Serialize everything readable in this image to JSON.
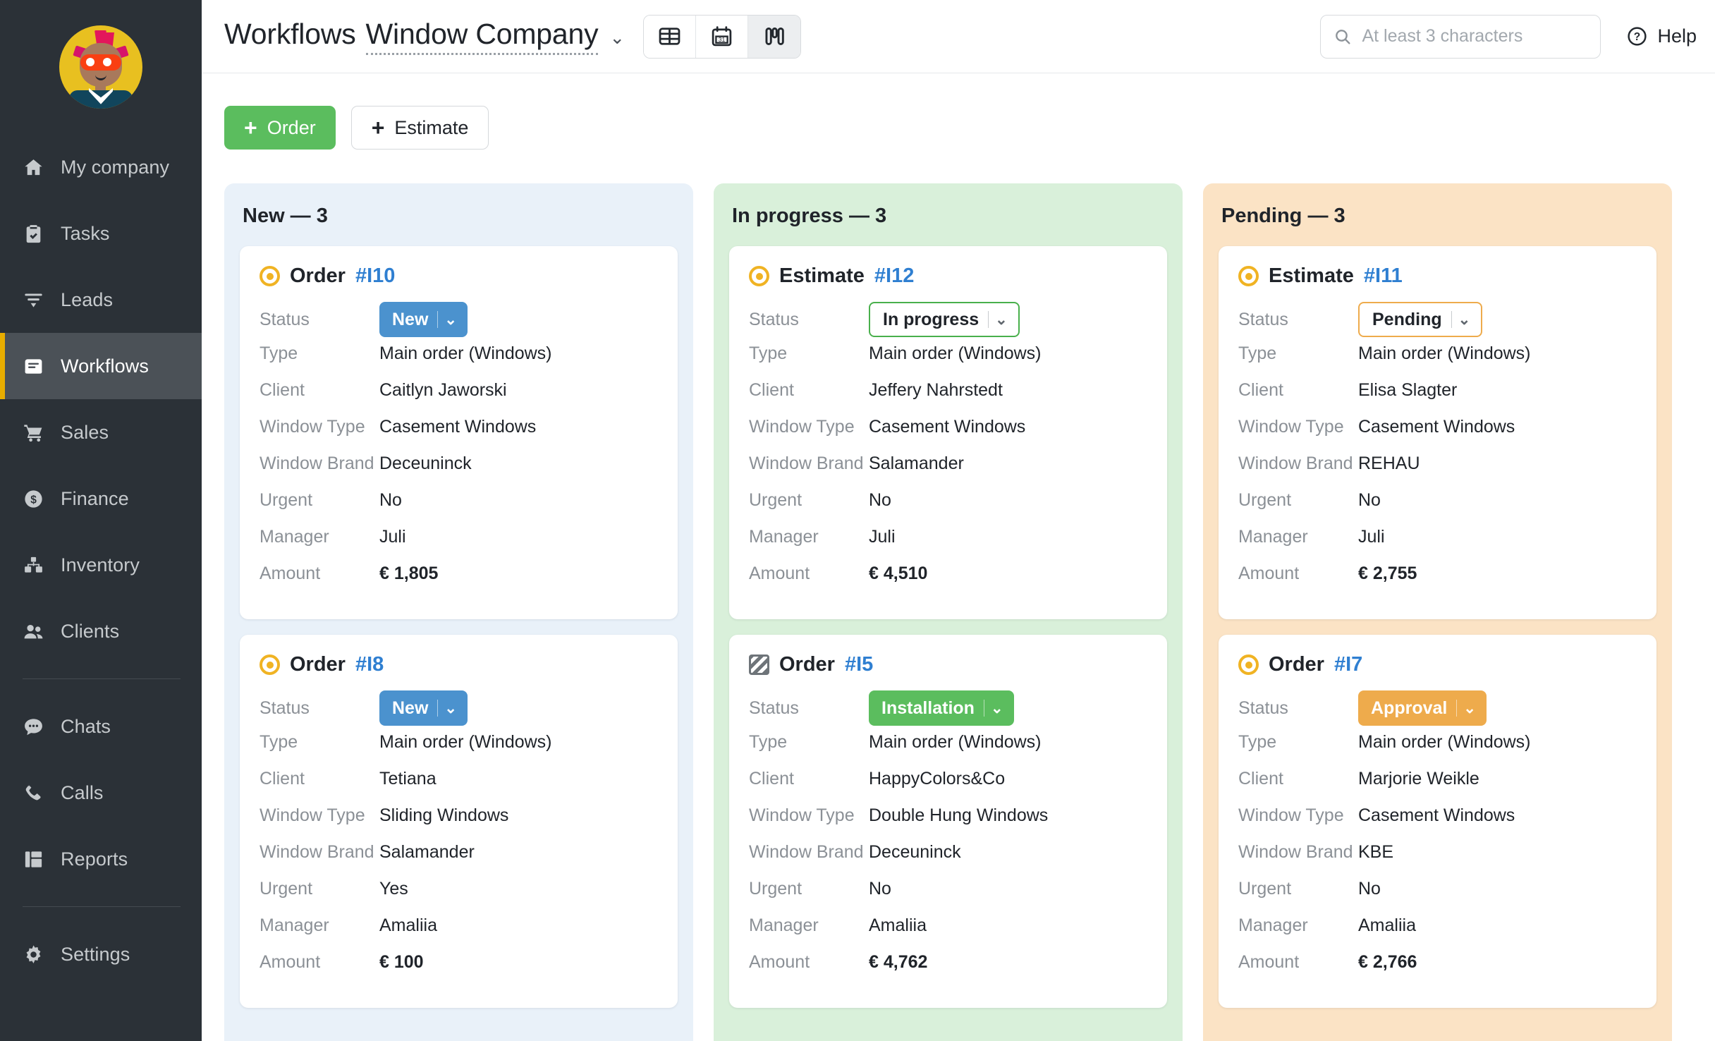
{
  "sidebar": {
    "avatar_name": "user-avatar",
    "items": [
      {
        "label": "My company",
        "icon": "home-icon",
        "active": false
      },
      {
        "label": "Tasks",
        "icon": "clipboard-check-icon",
        "active": false
      },
      {
        "label": "Leads",
        "icon": "funnel-icon",
        "active": false
      },
      {
        "label": "Workflows",
        "icon": "workflows-icon",
        "active": true
      },
      {
        "label": "Sales",
        "icon": "cart-icon",
        "active": false
      },
      {
        "label": "Finance",
        "icon": "dollar-circle-icon",
        "active": false
      },
      {
        "label": "Inventory",
        "icon": "boxes-icon",
        "active": false
      },
      {
        "label": "Clients",
        "icon": "people-icon",
        "active": false
      },
      {
        "label": "Chats",
        "icon": "chat-bubble-icon",
        "active": false
      },
      {
        "label": "Calls",
        "icon": "phone-icon",
        "active": false
      },
      {
        "label": "Reports",
        "icon": "reports-grid-icon",
        "active": false
      },
      {
        "label": "Settings",
        "icon": "gear-icon",
        "active": false
      }
    ]
  },
  "header": {
    "page_title": "Workflows",
    "company": "Window Company",
    "company_chevron": "⌄",
    "views": [
      {
        "name": "table-view",
        "icon": "table-icon",
        "active": false
      },
      {
        "name": "calendar-view",
        "icon": "calendar-31-icon",
        "active": false
      },
      {
        "name": "kanban-view",
        "icon": "kanban-icon",
        "active": true
      }
    ],
    "search": {
      "placeholder": "At least 3 characters",
      "value": "",
      "icon": "search-icon"
    },
    "help": {
      "label": "Help",
      "icon": "question-circle-icon"
    }
  },
  "toolbar": {
    "order_label": "Order",
    "estimate_label": "Estimate",
    "plus": "+"
  },
  "field_labels": {
    "status": "Status",
    "type": "Type",
    "client": "Client",
    "window_type": "Window Type",
    "window_brand": "Window Brand",
    "urgent": "Urgent",
    "manager": "Manager",
    "amount": "Amount"
  },
  "colors": {
    "column_new": "#e9f1f9",
    "column_in_progress": "#d9f0da",
    "column_pending": "#fbe3c5",
    "badge_blue": "#4b92ce",
    "badge_green": "#5bbd5e",
    "badge_orange": "#eeab4c",
    "accent_sidebar": "#e8ad00",
    "primary_button": "#5bbd5e",
    "link_blue": "#2f7fd1",
    "doc_icon_yellow": "#f0b323"
  },
  "columns": [
    {
      "title": "New — 3",
      "tone": "blue",
      "cards": [
        {
          "doc_type": "Order",
          "doc_number": "#I10",
          "icon": "order-dot-icon",
          "status": {
            "label": "New",
            "style": "solid-blue",
            "chevron": "⌄"
          },
          "type": "Main order (Windows)",
          "client": "Caitlyn Jaworski",
          "window_type": "Casement Windows",
          "window_brand": "Deceuninck",
          "urgent": "No",
          "manager": "Juli",
          "amount": "€ 1,805"
        },
        {
          "doc_type": "Order",
          "doc_number": "#I8",
          "icon": "order-dot-icon",
          "status": {
            "label": "New",
            "style": "solid-blue",
            "chevron": "⌄"
          },
          "type": "Main order (Windows)",
          "client": "Tetiana",
          "window_type": "Sliding Windows",
          "window_brand": "Salamander",
          "urgent": "Yes",
          "manager": "Amaliia",
          "amount": "€ 100"
        }
      ]
    },
    {
      "title": "In progress — 3",
      "tone": "green",
      "cards": [
        {
          "doc_type": "Estimate",
          "doc_number": "#I12",
          "icon": "order-dot-icon",
          "status": {
            "label": "In progress",
            "style": "outline-green",
            "chevron": "⌄"
          },
          "type": "Main order (Windows)",
          "client": "Jeffery Nahrstedt",
          "window_type": "Casement Windows",
          "window_brand": "Salamander",
          "urgent": "No",
          "manager": "Juli",
          "amount": "€ 4,510"
        },
        {
          "doc_type": "Order",
          "doc_number": "#I5",
          "icon": "order-hatch-icon",
          "status": {
            "label": "Installation",
            "style": "solid-green",
            "chevron": "⌄"
          },
          "type": "Main order (Windows)",
          "client": "HappyColors&Co",
          "window_type": "Double Hung Windows",
          "window_brand": "Deceuninck",
          "urgent": "No",
          "manager": "Amaliia",
          "amount": "€ 4,762"
        }
      ]
    },
    {
      "title": "Pending — 3",
      "tone": "orange",
      "cards": [
        {
          "doc_type": "Estimate",
          "doc_number": "#I11",
          "icon": "order-dot-icon",
          "status": {
            "label": "Pending",
            "style": "outline-orange",
            "chevron": "⌄"
          },
          "type": "Main order (Windows)",
          "client": "Elisa Slagter",
          "window_type": "Casement Windows",
          "window_brand": "REHAU",
          "urgent": "No",
          "manager": "Juli",
          "amount": "€ 2,755"
        },
        {
          "doc_type": "Order",
          "doc_number": "#I7",
          "icon": "order-dot-icon",
          "status": {
            "label": "Approval",
            "style": "solid-orange",
            "chevron": "⌄"
          },
          "type": "Main order (Windows)",
          "client": "Marjorie Weikle",
          "window_type": "Casement Windows",
          "window_brand": "KBE",
          "urgent": "No",
          "manager": "Amaliia",
          "amount": "€ 2,766"
        }
      ]
    }
  ]
}
